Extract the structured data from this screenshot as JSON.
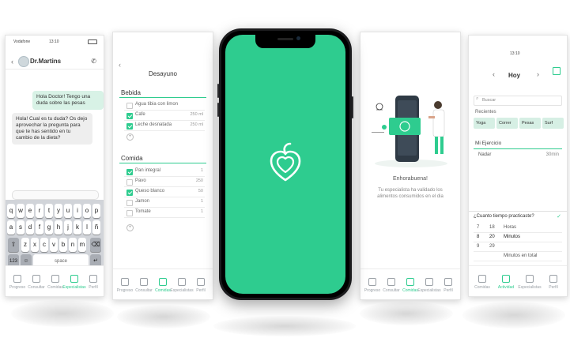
{
  "colors": {
    "brand_green": "#2ecc8f",
    "bubble_green": "#d8f2e6",
    "bubble_grey": "#eeeeee",
    "keyboard_bg": "#d1d4d9"
  },
  "chat": {
    "status_left": "Vodafone",
    "status_time": "13:10",
    "doctor_name": "Dr.Martins",
    "msg_out": "Hola Doctor! Tengo una duda sobre las pesas",
    "msg_in": "Hola! Cual es tu duda? Os dejo aprovechar la pregunta para que te has sentido en tu cambio de la dieta?",
    "keyboard_row1": [
      "q",
      "w",
      "e",
      "r",
      "t",
      "y",
      "u",
      "i",
      "o",
      "p"
    ],
    "keyboard_row2": [
      "a",
      "s",
      "d",
      "f",
      "g",
      "h",
      "j",
      "k",
      "l",
      "ñ"
    ],
    "keyboard_row3": [
      "z",
      "x",
      "c",
      "v",
      "b",
      "n",
      "m"
    ],
    "key_123": "123",
    "key_space": "space",
    "tabs": [
      "Progreso",
      "Consultar",
      "Comidas",
      "Especialistas",
      "Perfil"
    ]
  },
  "meal": {
    "title": "Desayuno",
    "section1_title": "Bebida",
    "section1_items": [
      {
        "label": "Agua tibia con limon",
        "qty": "",
        "checked": false
      },
      {
        "label": "Cafe",
        "qty": "250 ml",
        "checked": true
      },
      {
        "label": "Leche desnatada",
        "qty": "250 ml",
        "checked": true
      }
    ],
    "section2_title": "Comida",
    "section2_items": [
      {
        "label": "Pan integral",
        "qty": "1",
        "checked": true
      },
      {
        "label": "Pavo",
        "qty": "250",
        "checked": false
      },
      {
        "label": "Queso blanco",
        "qty": "50",
        "checked": true
      },
      {
        "label": "Jamon",
        "qty": "1",
        "checked": false
      },
      {
        "label": "Tomate",
        "qty": "1",
        "checked": false
      }
    ],
    "tabs": [
      "Progreso",
      "Consultar",
      "Comidas",
      "Especialistas",
      "Perfil"
    ]
  },
  "welcome": {
    "title": "Enhorabuena!",
    "body": "Tu especialista ha validado los alimentos consumidos en el dia",
    "tabs": [
      "Progreso",
      "Consultar",
      "Comidas",
      "Especialistas",
      "Perfil"
    ]
  },
  "activity": {
    "status_time": "13:10",
    "day_label": "Hoy",
    "search_value": "Buscar",
    "section_label": "Recientes",
    "chips": [
      "Yoga",
      "Correr",
      "Pesas",
      "Surf"
    ],
    "exercise_section": "Mi Ejercicio",
    "exercise_name": "Nadar",
    "exercise_time": "30min",
    "question": "¿Cuanto tiempo practicaste?",
    "time_rows": [
      {
        "h": "7",
        "m": "18",
        "u": "Horas"
      },
      {
        "h": "8",
        "m": "20",
        "u": "Minutos"
      },
      {
        "h": "9",
        "m": "29",
        "u": ""
      },
      {
        "h": "",
        "m": "",
        "u": "Minutos en total"
      }
    ],
    "tabs": [
      "Comidas",
      "Actividad",
      "Especialistas",
      "Perfil"
    ]
  }
}
